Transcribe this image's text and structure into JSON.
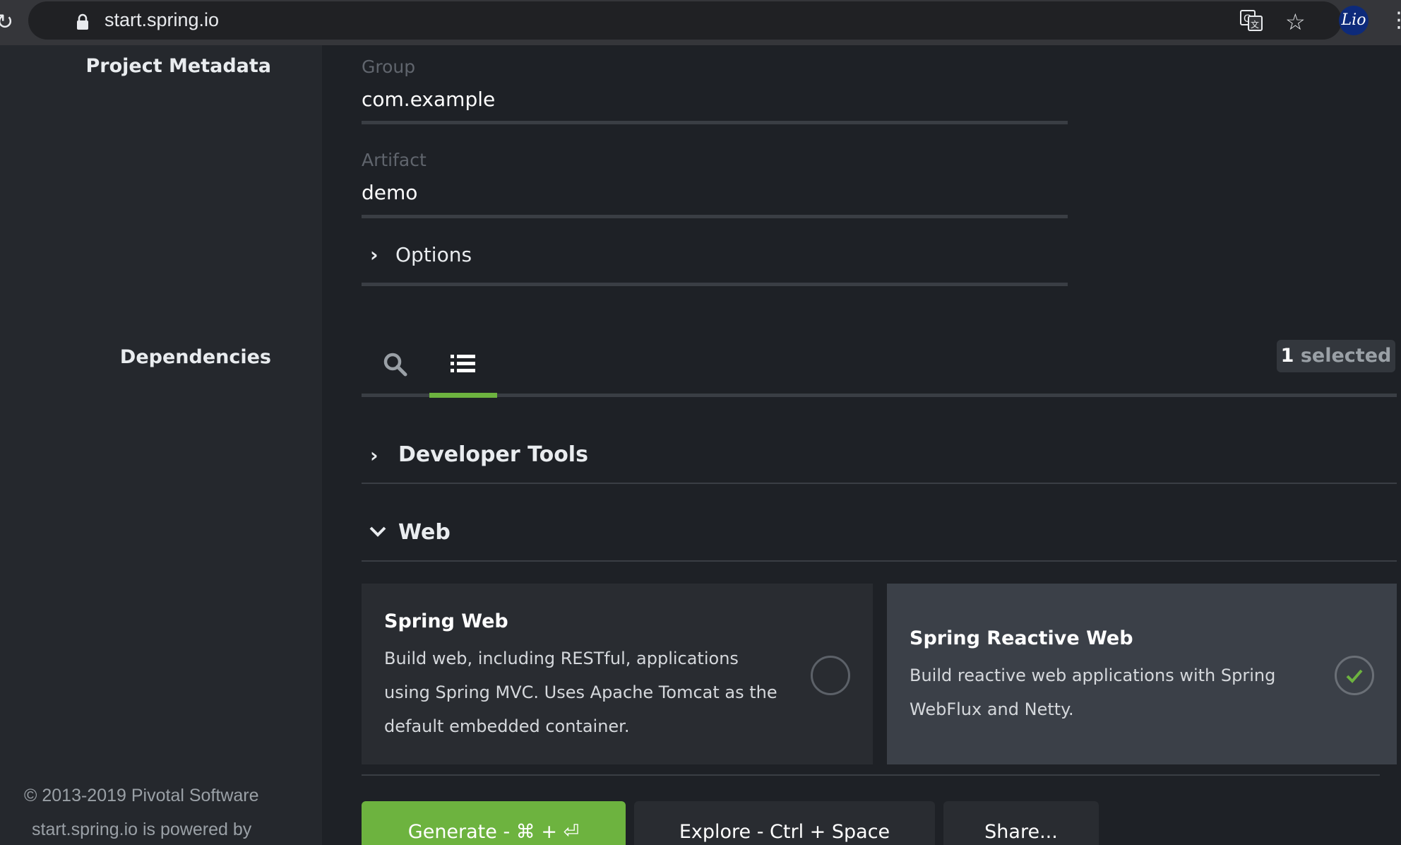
{
  "browser": {
    "url": "start.spring.io",
    "avatar_text": "Lio"
  },
  "sidebar": {
    "project_metadata_label": "Project Metadata",
    "dependencies_label": "Dependencies",
    "footer_copyright": "© 2013-2019 Pivotal Software",
    "footer_powered": "start.spring.io is powered by"
  },
  "metadata": {
    "group": {
      "label": "Group",
      "value": "com.example"
    },
    "artifact": {
      "label": "Artifact",
      "value": "demo"
    },
    "options_label": "Options"
  },
  "dependencies": {
    "tabs": [
      {
        "icon": "search-icon",
        "active": false
      },
      {
        "icon": "list-icon",
        "active": true
      }
    ],
    "selected_count": "1",
    "selected_suffix": " selected",
    "groups": [
      {
        "title": "Developer Tools",
        "expanded": false
      },
      {
        "title": "Web",
        "expanded": true
      }
    ],
    "cards": [
      {
        "title": "Spring Web",
        "description_lines": [
          "Build web, including RESTful, applications",
          "using Spring MVC. Uses Apache Tomcat as the",
          "default embedded container."
        ],
        "selected": false
      },
      {
        "title": "Spring Reactive Web",
        "description_lines": [
          "Build reactive web applications with Spring",
          "WebFlux and Netty."
        ],
        "selected": true
      }
    ]
  },
  "actions": {
    "generate": "Generate - ⌘ + ⏎",
    "explore": "Explore - Ctrl + Space",
    "share": "Share..."
  },
  "colors": {
    "accent": "#6db33f",
    "background": "#1e2126",
    "sidebar": "#25282d"
  }
}
